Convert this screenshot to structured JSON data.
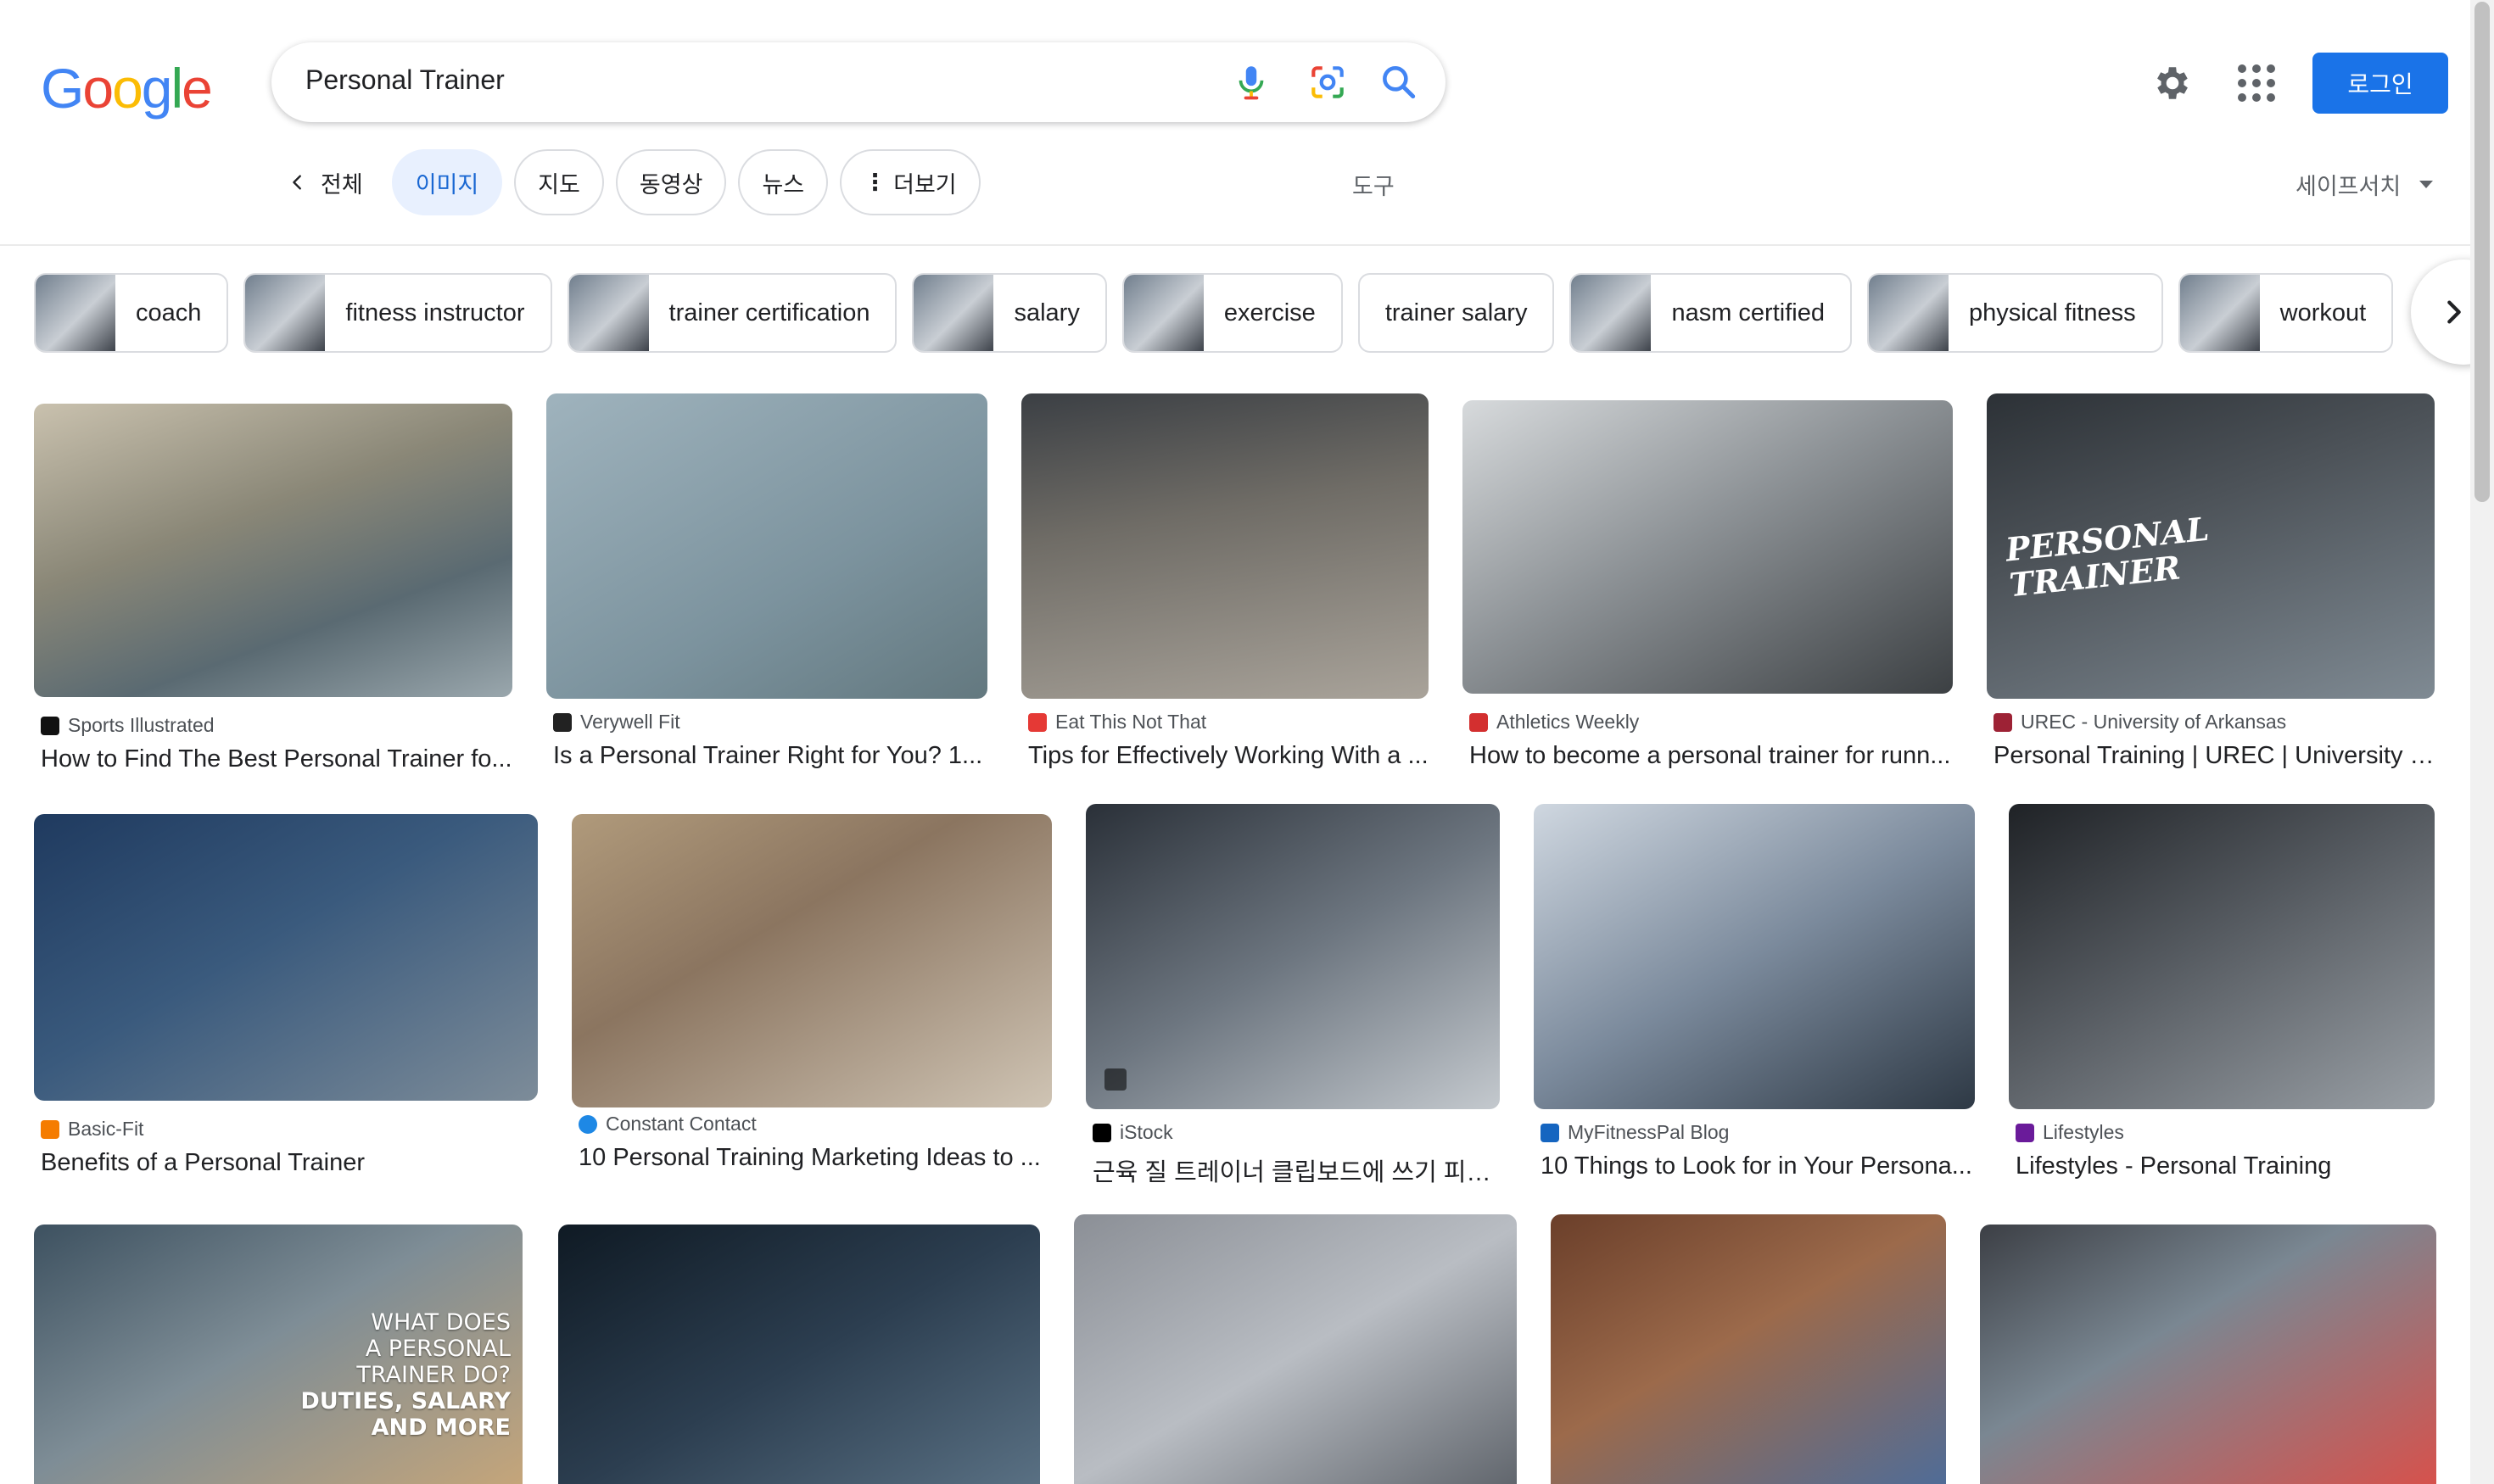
{
  "header": {
    "logo": {
      "l1": "G",
      "l2": "o",
      "l3": "o",
      "l4": "g",
      "l5": "l",
      "l6": "e"
    },
    "search_value": "Personal Trainer",
    "login_label": "로그인"
  },
  "tabs": {
    "back_label": "전체",
    "items": [
      {
        "label": "이미지"
      },
      {
        "label": "지도"
      },
      {
        "label": "동영상"
      },
      {
        "label": "뉴스"
      },
      {
        "label": "더보기"
      }
    ],
    "tools_label": "도구",
    "safesearch_label": "세이프서치"
  },
  "chips": [
    {
      "label": "coach"
    },
    {
      "label": "fitness instructor"
    },
    {
      "label": "trainer certification"
    },
    {
      "label": "salary"
    },
    {
      "label": "exercise"
    },
    {
      "label": "trainer salary"
    },
    {
      "label": "nasm certified"
    },
    {
      "label": "physical fitness"
    },
    {
      "label": "workout"
    }
  ],
  "results": [
    {
      "source": "Sports Illustrated",
      "title": "How to Find The Best Personal Trainer fo...",
      "fav_color": "#111111"
    },
    {
      "source": "Verywell Fit",
      "title": "Is a Personal Trainer Right for You? 1...",
      "fav_color": "#222222"
    },
    {
      "source": "Eat This Not That",
      "title": "Tips for Effectively Working With a ...",
      "fav_color": "#e53935"
    },
    {
      "source": "Athletics Weekly",
      "title": "How to become a personal trainer for runn...",
      "fav_color": "#d32f2f"
    },
    {
      "source": "UREC - University of Arkansas",
      "title": "Personal Training | UREC | University o...",
      "fav_color": "#9d2235"
    },
    {
      "source": "Basic-Fit",
      "title": "Benefits of a Personal Trainer",
      "fav_color": "#f57c00"
    },
    {
      "source": "Constant Contact",
      "title": "10 Personal Training Marketing Ideas to ...",
      "fav_color": "#1e88e5"
    },
    {
      "source": "iStock",
      "title": "근육 질 트레이너 클립보드에 쓰기 피트...",
      "fav_color": "#000000"
    },
    {
      "source": "MyFitnessPal Blog",
      "title": "10 Things to Look for in Your Persona...",
      "fav_color": "#1565c0"
    },
    {
      "source": "Lifestyles",
      "title": "Lifestyles - Personal Training",
      "fav_color": "#6a1b9a"
    }
  ],
  "image_overlays": {
    "urec": "PERSONAL TRAINER",
    "what_does_1": "WHAT DOES",
    "what_does_2": "A PERSONAL",
    "what_does_3": "TRAINER DO?",
    "what_does_4": "DUTIES, SALARY",
    "what_does_5": "AND MORE"
  }
}
